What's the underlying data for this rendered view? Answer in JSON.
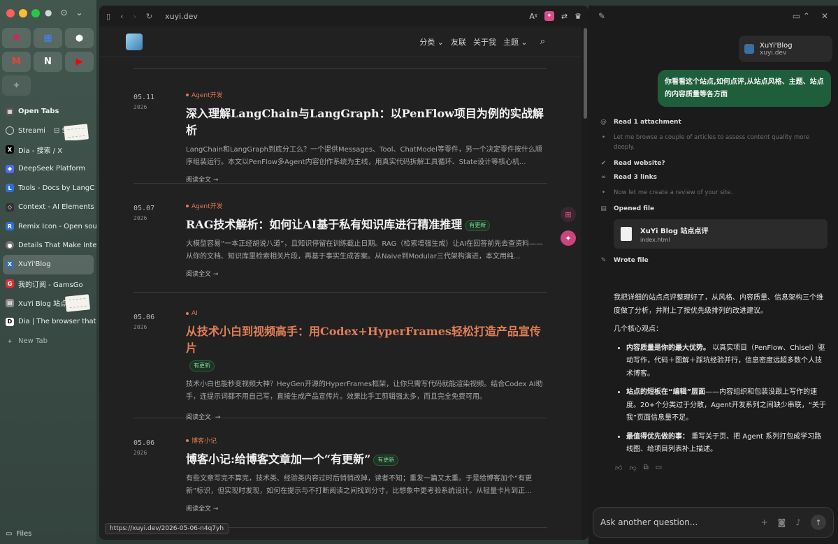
{
  "sidebar": {
    "pinned": [
      {
        "icon": "slack-icon",
        "glyph": "✱",
        "color": "#e01e5a"
      },
      {
        "icon": "google-calendar-icon",
        "glyph": "▦",
        "color": "#4285f4"
      },
      {
        "icon": "github-icon",
        "glyph": "●",
        "color": "#ffffff"
      },
      {
        "icon": "gmail-icon",
        "glyph": "M",
        "color": "#ea4335"
      },
      {
        "icon": "notion-icon",
        "glyph": "N",
        "color": "#ffffff"
      },
      {
        "icon": "youtube-icon",
        "glyph": "▶",
        "color": "#ff0000"
      }
    ],
    "open_tabs_label": "Open Tabs",
    "tabs": [
      {
        "label": "Streami",
        "color": "#555",
        "glyph": "◌"
      },
      {
        "label": "Dia - 搜索 / X",
        "color": "#000000",
        "glyph": "X"
      },
      {
        "label": "DeepSeek Platform",
        "color": "#4d6bfe",
        "glyph": "◆"
      },
      {
        "label": "Tools - Docs by LangC",
        "color": "#2f6fd6",
        "glyph": "L"
      },
      {
        "label": "Context - AI Elements",
        "color": "#333",
        "glyph": "◇"
      },
      {
        "label": "Remix Icon - Open sou",
        "color": "#2f6fd6",
        "glyph": "R"
      },
      {
        "label": "Details That Make Inte",
        "color": "#777",
        "glyph": "●"
      },
      {
        "label": "XuYi'Blog",
        "color": "#3b6fa2",
        "glyph": "X"
      },
      {
        "label": "我的订阅 - GamsGo",
        "color": "#d33",
        "glyph": "G"
      },
      {
        "label": "XuYi Blog 站点点",
        "color": "#888",
        "glyph": "▤"
      },
      {
        "label": "Dia | The browser that",
        "color": "#222",
        "glyph": "D"
      }
    ],
    "new_tab_label": "New Tab",
    "files_label": "Files"
  },
  "browser": {
    "url": "xuyi.dev",
    "nav": {
      "categories": "分类",
      "friends": "友联",
      "about": "关于我",
      "theme": "主题"
    },
    "read_more": "阅读全文",
    "posts": [
      {
        "date": "05.11",
        "year": "2026",
        "category": "Agent开发",
        "title": "深入理解LangChain与LangGraph：以PenFlow项目为例的实战解析",
        "badge": "",
        "excerpt": "LangChain和LangGraph到底分工么？一个提供Messages、Tool、ChatModel等零件，另一个决定零件按什么顺序组装运行。本文以PenFlow多Agent内容创作系统为主线，用真实代码拆解工具循环、State设计等核心机..."
      },
      {
        "date": "05.07",
        "year": "2026",
        "category": "Agent开发",
        "title": "RAG技术解析：如何让AI基于私有知识库进行精准推理",
        "badge": "有更新",
        "excerpt": "大模型容易“一本正经胡说八道”，且知识停留在训练截止日期。RAG（检索增强生成）让AI在回答前先去查资料——从你的文档、知识库里检索相关片段，再基于事实生成答案。从Naive到Modular三代架构演进，本文用纯..."
      },
      {
        "date": "05.06",
        "year": "2026",
        "category": "AI",
        "title": "从技术小白到视频高手：用Codex+HyperFrames轻松打造产品宣传片",
        "badge": "有更新",
        "excerpt": "技术小白也能秒变视频大神？HeyGen开源的HyperFrames框架，让你只需写代码就能渲染视频。结合Codex AI助手，连提示词都不用自己写，直接生成产品宣传片。效果比手工剪辑强太多，而且完全免费可用。"
      },
      {
        "date": "05.06",
        "year": "2026",
        "category": "博客小记",
        "title": "博客小记:给博客文章加一个“有更新”",
        "badge": "有更新",
        "excerpt": "有些文章写完不算完，技术类、经验类内容过时后悄悄改掉，读者不知；重发一篇又太重。于是给博客加个“有更新”标识，但实现时发现，如何在提示与不打断阅读之间找到分寸，比想象中更考验系统设计。从轻量卡片到正..."
      }
    ],
    "status_url": "https://xuyi.dev/2026-05-06-n4q7yh"
  },
  "assistant": {
    "attachment": {
      "title": "XuYi'Blog",
      "subtitle": "xuyi.dev"
    },
    "user_message": "你看看这个站点,如何点评,从站点风格、主题、站点的内容质量等各方面",
    "steps": {
      "read_attachment": "Read 1 attachment",
      "thought1": "Let me browse a couple of articles to assess content quality more deeply.",
      "read_website": "Read website?",
      "read_links": "Read 3 links",
      "thought2": "Now let me create a review of your site.",
      "opened_file": "Opened file",
      "wrote_file": "Wrote file"
    },
    "file_card": {
      "title": "XuYi Blog 站点点评",
      "subtitle": "index.html"
    },
    "answer": {
      "intro": "我把详细的站点点评整理好了，从风格、内容质量、信息架构三个维度做了分析，并附上了按优先级排列的改进建议。",
      "heading": "几个核心观点：",
      "points": [
        {
          "bold": "内容质量是你的最大优势。",
          "rest": "以真实项目（PenFlow、Chisel）驱动写作，代码＋图解＋踩坑经验并行，信息密度远超多数个人技术博客。"
        },
        {
          "bold": "站点的短板在“编辑”层面",
          "rest": "——内容组织和包装没跟上写作的速度。20+个分类过于分散，Agent开发系列之间缺少串联，“关于我”页面信息量不足。"
        },
        {
          "bold": "最值得优先做的事：",
          "rest": "重写关于页、把 Agent 系列打包成学习路线图、给项目列表补上描述。"
        }
      ]
    },
    "input_placeholder": "Ask another question..."
  }
}
